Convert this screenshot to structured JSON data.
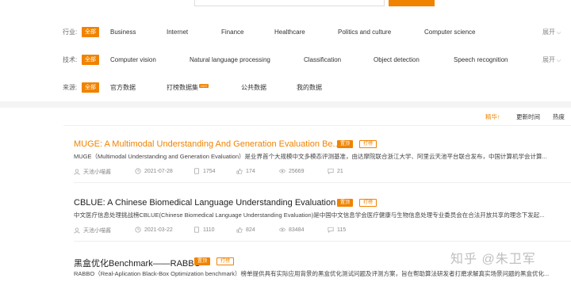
{
  "filters": {
    "industry": {
      "label": "行业:",
      "all": "全部",
      "options": [
        "Business",
        "Internet",
        "Finance",
        "Healthcare",
        "Politics and culture",
        "Computer science"
      ],
      "expand": "展开"
    },
    "technology": {
      "label": "技术:",
      "all": "全部",
      "options": [
        "Computer vision",
        "Natural language processing",
        "Classification",
        "Object detection",
        "Speech recognition"
      ],
      "expand": "展开"
    },
    "source": {
      "label": "来源:",
      "all": "全部",
      "options": [
        "官方数据",
        "打榜数据集",
        "公共数据",
        "我的数据"
      ],
      "hot_badge": "HOT"
    }
  },
  "sort": {
    "options": [
      "精华↑",
      "更新时间",
      "热度"
    ]
  },
  "datasets": [
    {
      "title": "MUGE: A Multimodal Understanding And Generation Evaluation Be...",
      "tags": [
        "置顶",
        "打榜"
      ],
      "description": "MUGE（Multimodal Understanding and Generation Evaluation）是业界首个大规模中文多模态评测基准，由达摩院联合浙江大学、阿里云天池平台联合发布，中国计算机学会计算...",
      "author": "天池小喵酱",
      "date": "2021-07-28",
      "stats": [
        "1754",
        "174",
        "25669",
        "21"
      ]
    },
    {
      "title": "CBLUE: A Chinese Biomedical Language Understanding Evaluation ...",
      "tags": [
        "置顶",
        "打榜"
      ],
      "description": "中文医疗信息处理挑战榜CBLUE(Chinese Biomedical Language Understanding Evaluation)是中国中文信息学会医疗健康与生物信息处理专业委员会在合法开放共享的理念下发起...",
      "author": "天池小喵酱",
      "date": "2021-03-22",
      "stats": [
        "1110",
        "824",
        "83484",
        "115"
      ]
    },
    {
      "title": "黑盒优化Benchmark——RABBO",
      "tags": [
        "置顶",
        "打榜"
      ],
      "description": "RABBO（Real-Aplication Black-Box Optimization benchmark）榜单提供具有实际应用背景的黑盒优化测试问题及评测方案，旨在帮助算法研发者打磨求解真实场景问题的黑盒优化...",
      "author": "",
      "date": "",
      "stats": []
    }
  ],
  "watermark": "知乎 @朱卫军",
  "colors": {
    "accent": "#f08300"
  }
}
